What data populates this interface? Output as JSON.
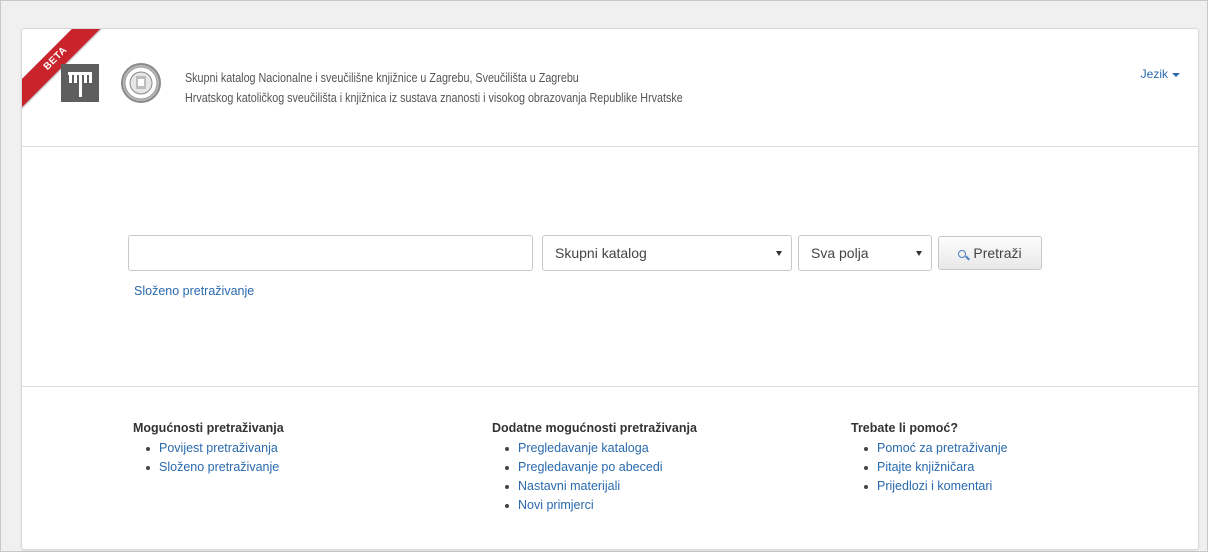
{
  "badge": "BETA",
  "header": {
    "line1": "Skupni katalog Nacionalne i sveučilišne knjižnice u Zagrebu, Sveučilišta u Zagrebu",
    "line2": "Hrvatskog katoličkog sveučilišta i knjižnica iz sustava znanosti i visokog obrazovanja Republike Hrvatske",
    "language_menu": "Jezik"
  },
  "search": {
    "input_value": "",
    "catalog_select": "Skupni katalog",
    "fields_select": "Sva polja",
    "button_label": "Pretraži",
    "advanced_link": "Složeno pretraživanje"
  },
  "footer": {
    "columns": [
      {
        "title": "Mogućnosti pretraživanja",
        "links": [
          "Povijest pretraživanja",
          "Složeno pretraživanje"
        ]
      },
      {
        "title": "Dodatne mogućnosti pretraživanja",
        "links": [
          "Pregledavanje kataloga",
          "Pregledavanje po abecedi",
          "Nastavni materijali",
          "Novi primjerci"
        ]
      },
      {
        "title": "Trebate li pomoć?",
        "links": [
          "Pomoć za pretraživanje",
          "Pitajte knjižničara",
          "Prijedlozi i komentari"
        ]
      }
    ]
  },
  "colors": {
    "link": "#2a6aad",
    "ribbon": "#c9232b",
    "logo": "#5e5e5e"
  }
}
